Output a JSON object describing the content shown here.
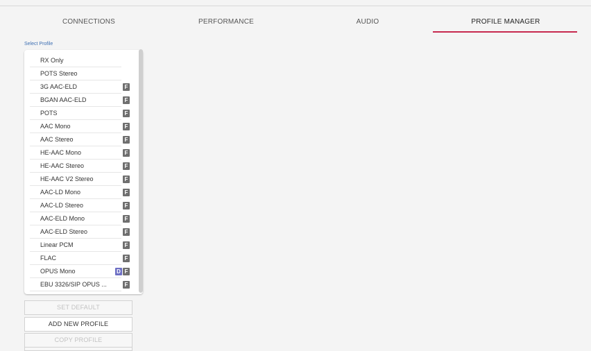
{
  "tabs": [
    {
      "label": "CONNECTIONS"
    },
    {
      "label": "PERFORMANCE"
    },
    {
      "label": "AUDIO"
    },
    {
      "label": "PROFILE MANAGER"
    }
  ],
  "active_tab": "PROFILE MANAGER",
  "colors": {
    "accent": "#c6284e",
    "label_blue": "#3d6fb3",
    "badge_f": "#6f6f6f",
    "badge_d": "#6d6fc4"
  },
  "select_profile_label": "Select Profile",
  "profiles": [
    {
      "name": "RX Only",
      "badges": []
    },
    {
      "name": "POTS Stereo",
      "badges": []
    },
    {
      "name": "3G AAC-ELD",
      "badges": [
        "F"
      ]
    },
    {
      "name": "BGAN AAC-ELD",
      "badges": [
        "F"
      ]
    },
    {
      "name": "POTS",
      "badges": [
        "F"
      ]
    },
    {
      "name": "AAC Mono",
      "badges": [
        "F"
      ]
    },
    {
      "name": "AAC Stereo",
      "badges": [
        "F"
      ]
    },
    {
      "name": "HE-AAC Mono",
      "badges": [
        "F"
      ]
    },
    {
      "name": "HE-AAC Stereo",
      "badges": [
        "F"
      ]
    },
    {
      "name": "HE-AAC V2 Stereo",
      "badges": [
        "F"
      ]
    },
    {
      "name": "AAC-LD Mono",
      "badges": [
        "F"
      ]
    },
    {
      "name": "AAC-LD Stereo",
      "badges": [
        "F"
      ]
    },
    {
      "name": "AAC-ELD Mono",
      "badges": [
        "F"
      ]
    },
    {
      "name": "AAC-ELD Stereo",
      "badges": [
        "F"
      ]
    },
    {
      "name": "Linear PCM",
      "badges": [
        "F"
      ]
    },
    {
      "name": "FLAC",
      "badges": [
        "F"
      ]
    },
    {
      "name": "OPUS Mono",
      "badges": [
        "D",
        "F"
      ]
    },
    {
      "name": "EBU 3326/SIP OPUS ...",
      "badges": [
        "F"
      ]
    }
  ],
  "buttons": {
    "set_default": "SET DEFAULT",
    "add_new_profile": "ADD NEW PROFILE",
    "copy_profile": "COPY PROFILE"
  }
}
